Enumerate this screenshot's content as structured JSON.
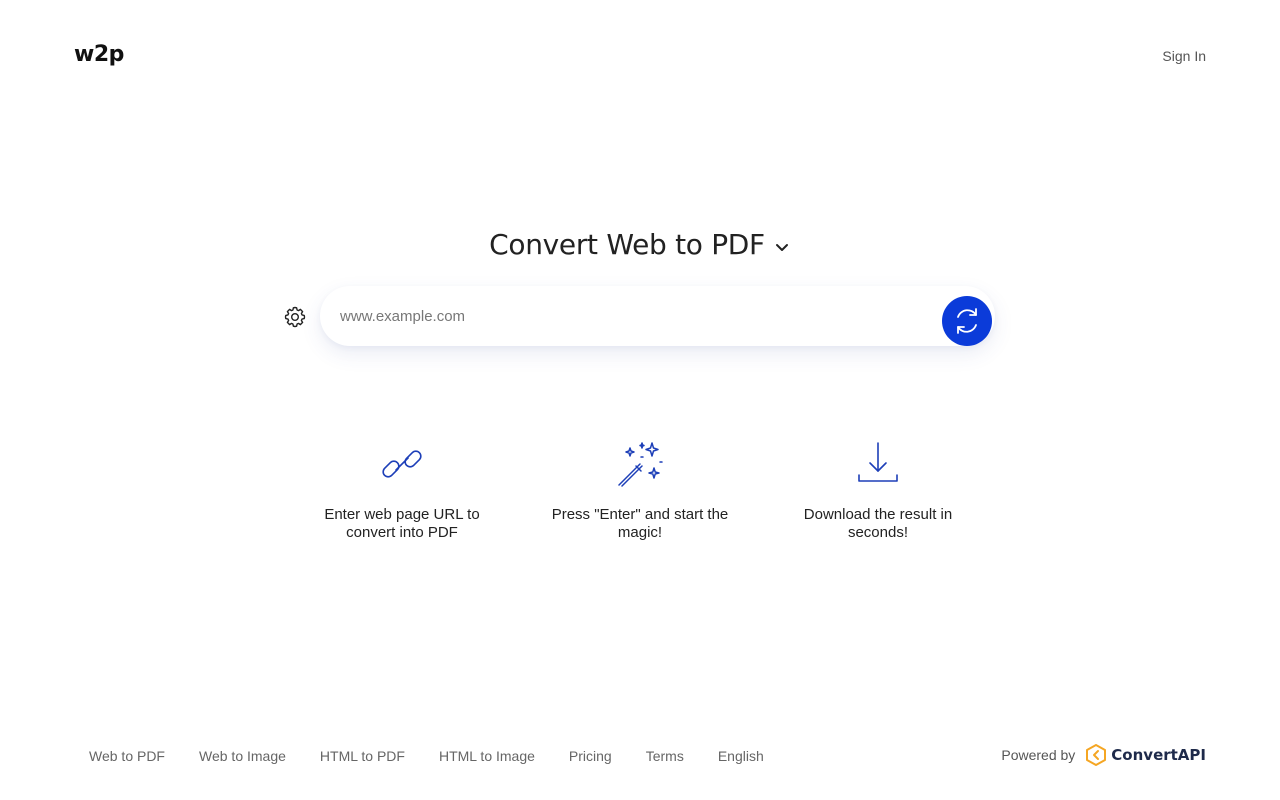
{
  "header": {
    "logo": "w2p",
    "sign_in": "Sign In"
  },
  "hero": {
    "title": "Convert Web to PDF",
    "chevron_icon": "chevron-down-icon"
  },
  "search": {
    "placeholder": "www.example.com",
    "value": "",
    "settings_icon": "gear-icon",
    "submit_icon": "refresh-icon"
  },
  "steps": [
    {
      "icon": "link-icon",
      "label": "Enter web page URL to convert into PDF"
    },
    {
      "icon": "magic-wand-icon",
      "label": "Press \"Enter\" and start the magic!"
    },
    {
      "icon": "download-icon",
      "label": "Download the result in seconds!"
    }
  ],
  "footer": {
    "links": [
      "Web to PDF",
      "Web to Image",
      "HTML to PDF",
      "HTML to Image",
      "Pricing",
      "Terms",
      "English"
    ],
    "powered_by": "Powered by",
    "brand": "ConvertAPI"
  },
  "colors": {
    "accent": "#0b3bd9",
    "icon_blue": "#1d3fb8",
    "brand_orange": "#f5a623"
  }
}
